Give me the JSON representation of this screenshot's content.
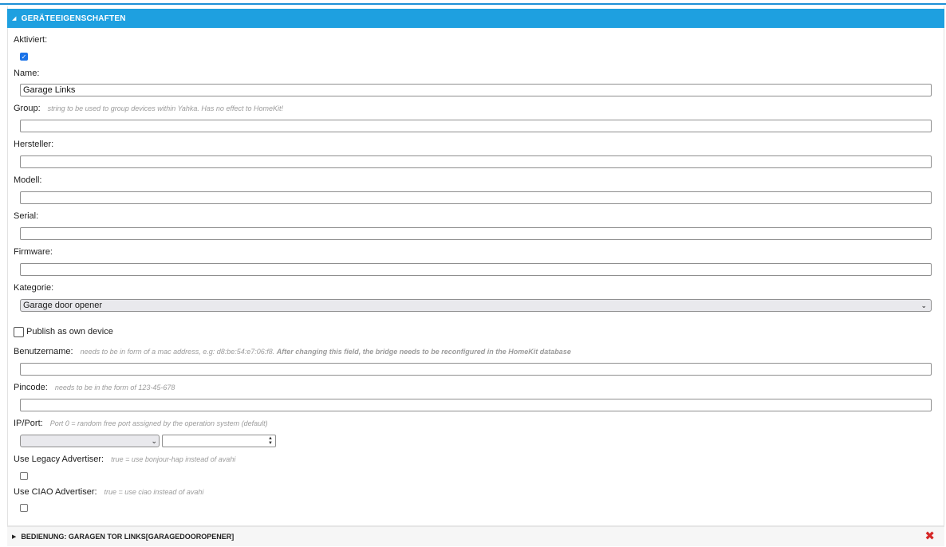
{
  "panel": {
    "header": "GERÄTEEIGENSCHAFTEN",
    "aktiviert_label": "Aktiviert:",
    "name_label": "Name:",
    "name_value": "Garage Links",
    "group_label": "Group:",
    "group_hint": "string to be used to group devices within Yahka. Has no effect to HomeKit!",
    "hersteller_label": "Hersteller:",
    "modell_label": "Modell:",
    "serial_label": "Serial:",
    "firmware_label": "Firmware:",
    "kategorie_label": "Kategorie:",
    "kategorie_value": "Garage door opener",
    "publish_label": "Publish as own device",
    "benutzername_label": "Benutzername:",
    "benutzername_hint": "needs to be in form of a mac address, e.g: d8:be:54:e7:06:f8.",
    "benutzername_hint_bold": "After changing this field, the bridge needs to be reconfigured in the HomeKit database",
    "pincode_label": "Pincode:",
    "pincode_hint": "needs to be in the form of 123-45-678",
    "ipport_label": "IP/Port:",
    "ipport_hint": "Port 0 = random free port assigned by the operation system (default)",
    "legacy_label": "Use Legacy Advertiser:",
    "legacy_hint": "true = use bonjour-hap instead of avahi",
    "ciao_label": "Use CIAO Advertiser:",
    "ciao_hint": "true = use ciao instead of avahi"
  },
  "footer": {
    "title": "BEDIENUNG: GARAGEN TOR LINKS[GARAGEDOOROPENER]"
  },
  "icons": {
    "expanded": "triangle-down-icon",
    "collapsed": "triangle-right-icon",
    "delete": "close-icon",
    "delete_color": "#d62828"
  },
  "colors": {
    "header_bg": "#1ea0e0",
    "checkbox_checked": "#1a73e8"
  }
}
